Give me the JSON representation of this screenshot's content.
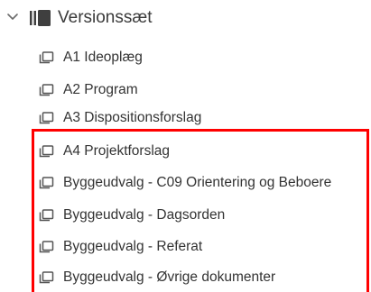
{
  "tree": {
    "root": {
      "label": "Versionssæt",
      "expand_icon": "chevron-down-icon",
      "icon": "version-set-icon"
    },
    "children": [
      {
        "label": "A1 Ideoplæg",
        "icon": "document-set-icon"
      },
      {
        "label": "A2 Program",
        "icon": "document-set-icon"
      },
      {
        "label": "A3 Dispositionsforslag",
        "icon": "document-set-icon"
      },
      {
        "label": "A4 Projektforslag",
        "icon": "document-set-icon"
      },
      {
        "label": "Byggeudvalg - C09 Orientering og Beboere",
        "icon": "document-set-icon"
      },
      {
        "label": "Byggeudvalg - Dagsorden",
        "icon": "document-set-icon"
      },
      {
        "label": "Byggeudvalg - Referat",
        "icon": "document-set-icon"
      },
      {
        "label": "Byggeudvalg - Øvrige dokumenter",
        "icon": "document-set-icon"
      }
    ]
  },
  "highlight": {
    "color": "#ff0000"
  }
}
